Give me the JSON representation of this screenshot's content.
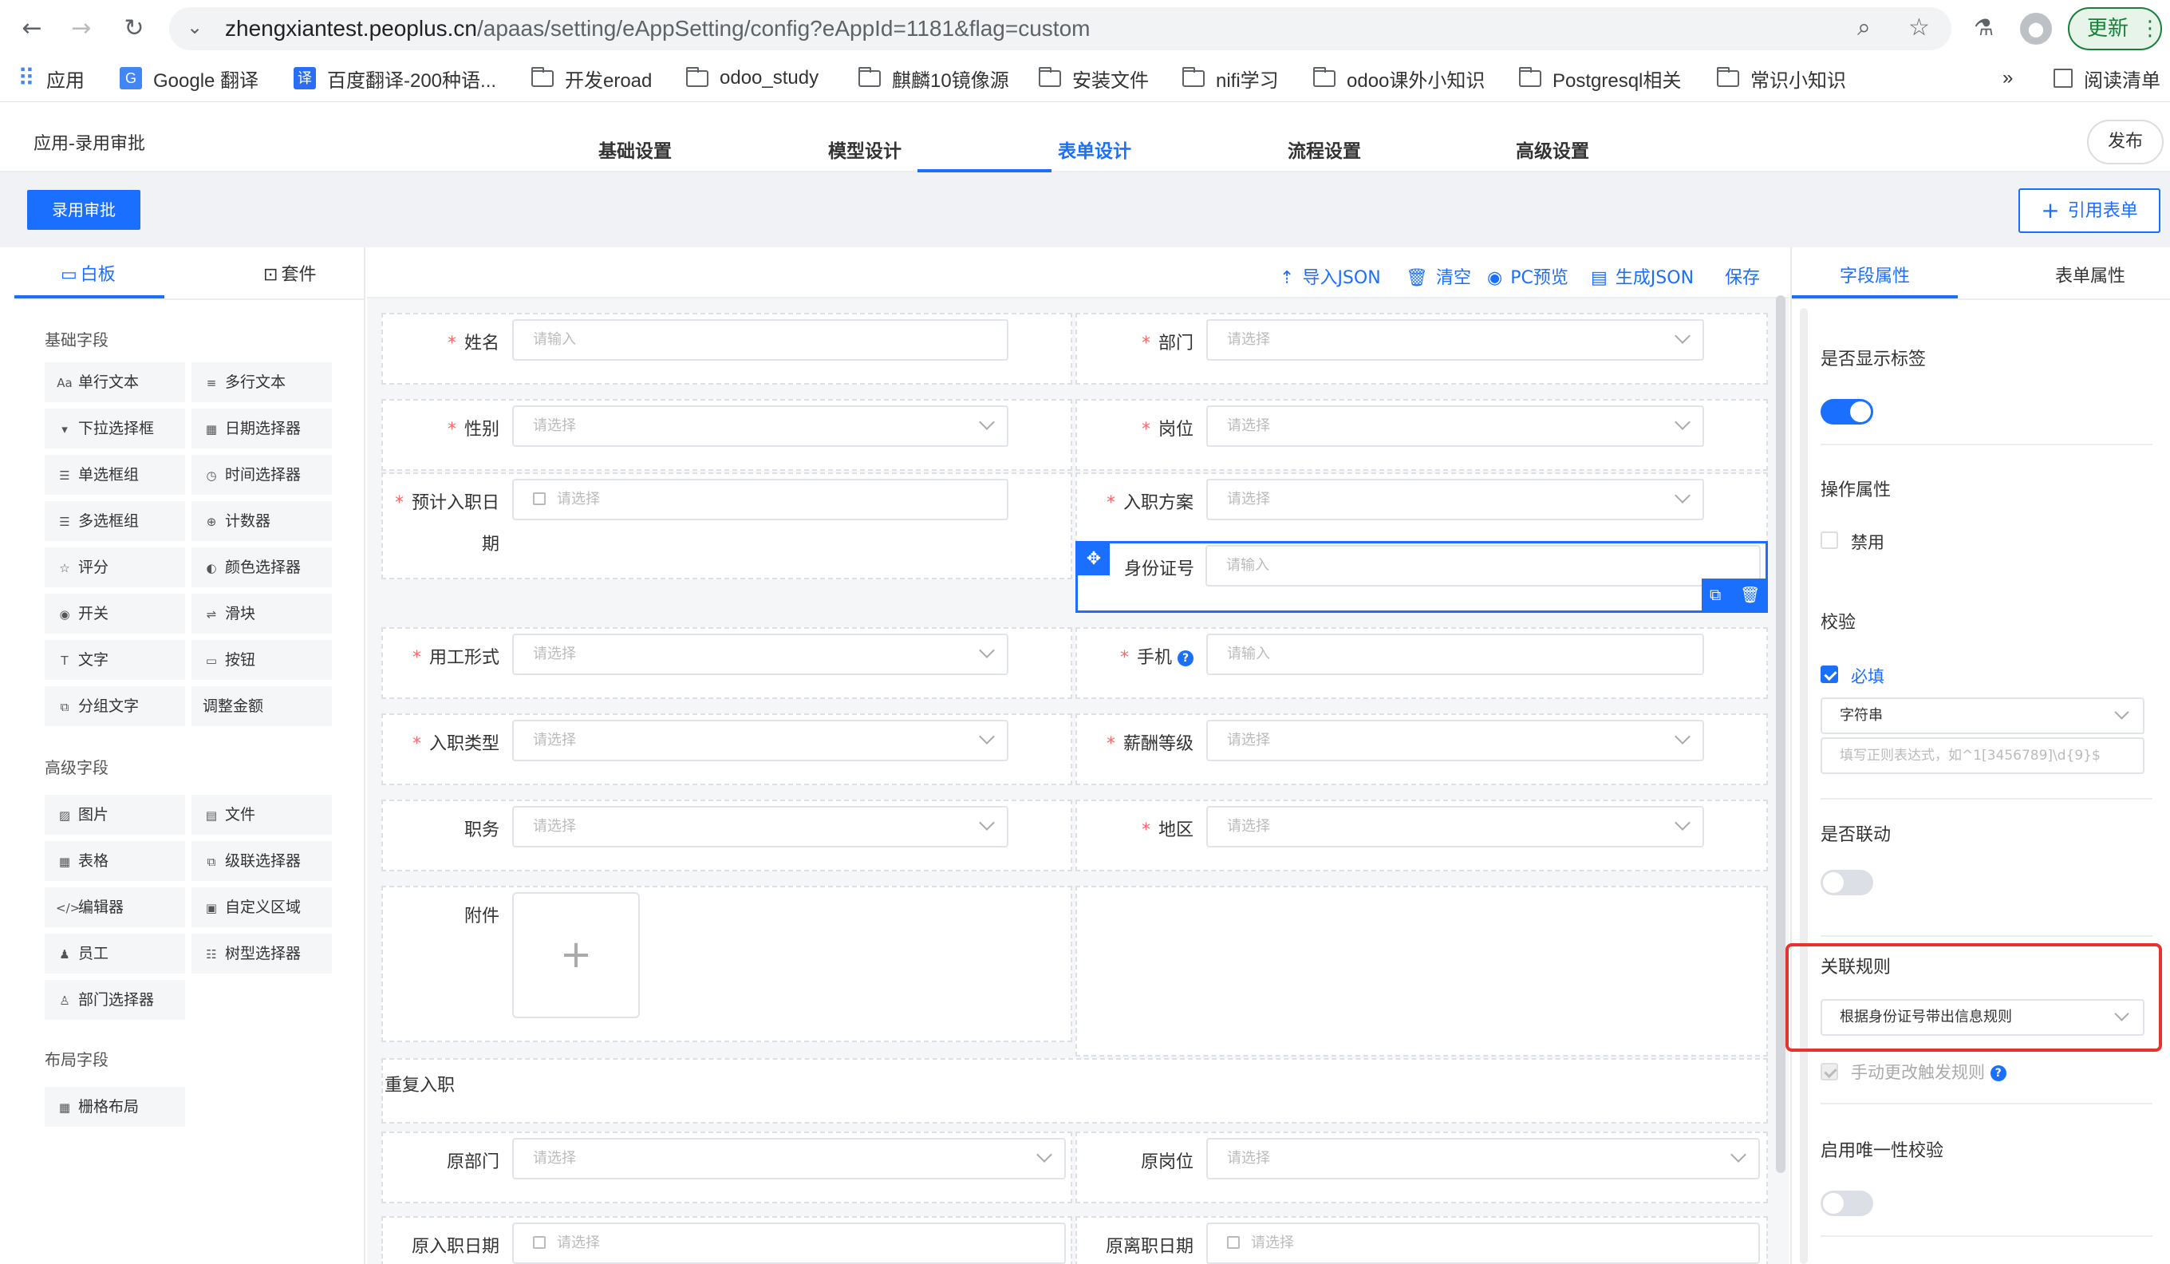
{
  "browser": {
    "url_host": "zhengxiantest.peoplus.cn",
    "url_path": "/apaas/setting/eAppSetting/config?eAppId=1181&flag=custom",
    "update_label": "更新",
    "bookmarks": [
      {
        "label": "应用",
        "icon": "apps-grid-icon"
      },
      {
        "label": "Google 翻译",
        "icon": "google-translate-icon"
      },
      {
        "label": "百度翻译-200种语...",
        "icon": "baidu-translate-icon"
      },
      {
        "label": "开发eroad",
        "icon": "folder-icon"
      },
      {
        "label": "odoo_study",
        "icon": "folder-icon"
      },
      {
        "label": "麒麟10镜像源",
        "icon": "folder-icon"
      },
      {
        "label": "安装文件",
        "icon": "folder-icon"
      },
      {
        "label": "nifi学习",
        "icon": "folder-icon"
      },
      {
        "label": "odoo课外小知识",
        "icon": "folder-icon"
      },
      {
        "label": "Postgresql相关",
        "icon": "folder-icon"
      },
      {
        "label": "常识小知识",
        "icon": "folder-icon"
      }
    ],
    "more_label": "»",
    "reading_list": "阅读清单"
  },
  "header": {
    "app_title": "应用-录用审批",
    "tabs": [
      "基础设置",
      "模型设计",
      "表单设计",
      "流程设置",
      "高级设置"
    ],
    "active_tab": "表单设计",
    "publish_label": "发布"
  },
  "toolbar": {
    "form_name": "录用审批",
    "ref_form_label": "引用表单"
  },
  "left_panel": {
    "tabs": [
      "白板",
      "套件"
    ],
    "basic_title": "基础字段",
    "basic_fields": [
      {
        "icon": "Aa",
        "label": "单行文本"
      },
      {
        "icon": "≡",
        "label": "多行文本"
      },
      {
        "icon": "▾",
        "label": "下拉选择框"
      },
      {
        "icon": "▦",
        "label": "日期选择器"
      },
      {
        "icon": "☰",
        "label": "单选框组"
      },
      {
        "icon": "◷",
        "label": "时间选择器"
      },
      {
        "icon": "☰",
        "label": "多选框组"
      },
      {
        "icon": "⊕",
        "label": "计数器"
      },
      {
        "icon": "☆",
        "label": "评分"
      },
      {
        "icon": "◐",
        "label": "颜色选择器"
      },
      {
        "icon": "◉",
        "label": "开关"
      },
      {
        "icon": "⇌",
        "label": "滑块"
      },
      {
        "icon": "T",
        "label": "文字"
      },
      {
        "icon": "▭",
        "label": "按钮"
      },
      {
        "icon": "⧉",
        "label": "分组文字"
      },
      {
        "icon": "",
        "label": "调整金额"
      }
    ],
    "advanced_title": "高级字段",
    "advanced_fields": [
      {
        "icon": "▨",
        "label": "图片"
      },
      {
        "icon": "▤",
        "label": "文件"
      },
      {
        "icon": "▦",
        "label": "表格"
      },
      {
        "icon": "⧉",
        "label": "级联选择器"
      },
      {
        "icon": "</>",
        "label": "编辑器"
      },
      {
        "icon": "▣",
        "label": "自定义区域"
      },
      {
        "icon": "♟",
        "label": "员工"
      },
      {
        "icon": "☷",
        "label": "树型选择器"
      },
      {
        "icon": "♙",
        "label": "部门选择器"
      }
    ],
    "layout_title": "布局字段",
    "layout_fields": [
      {
        "icon": "▦",
        "label": "栅格布局"
      }
    ]
  },
  "canvas_actions": [
    "导入JSON",
    "清空",
    "PC预览",
    "生成JSON",
    "保存"
  ],
  "form": {
    "placeholder_input": "请输入",
    "placeholder_select": "请选择",
    "name_label": "姓名",
    "dept_label": "部门",
    "gender_label": "性别",
    "position_label": "岗位",
    "expected_date_label_1": "预计入职日",
    "expected_date_label_2": "期",
    "plan_label": "入职方案",
    "id_card_label": "身份证号",
    "employment_form_label": "用工形式",
    "phone_label": "手机",
    "entry_type_label": "入职类型",
    "salary_level_label": "薪酬等级",
    "duty_label": "职务",
    "region_label": "地区",
    "attachment_label": "附件",
    "rehire_label": "重复入职",
    "orig_dept_label": "原部门",
    "orig_position_label": "原岗位",
    "orig_entry_date_label": "原入职日期",
    "orig_leave_date_label": "原离职日期",
    "upload_plus": "+",
    "help_mark": "?"
  },
  "right_panel": {
    "tabs": [
      "字段属性",
      "表单属性"
    ],
    "show_label_title": "是否显示标签",
    "show_label_on": true,
    "operation_title": "操作属性",
    "disable_label": "禁用",
    "validation_title": "校验",
    "required_label": "必填",
    "type_value": "字符串",
    "regex_placeholder": "填写正则表达式，如^1[3456789]\\d{9}$",
    "linkage_title": "是否联动",
    "linkage_on": false,
    "rule_title": "关联规则",
    "rule_value": "根据身份证号带出信息规则",
    "manual_trigger_label": "手动更改触发规则",
    "unique_title": "启用唯一性校验",
    "unique_on": false
  },
  "colors": {
    "primary": "#1a6fff",
    "required": "#f56c6c",
    "highlight": "#e8322f",
    "update_green": "#188038"
  }
}
